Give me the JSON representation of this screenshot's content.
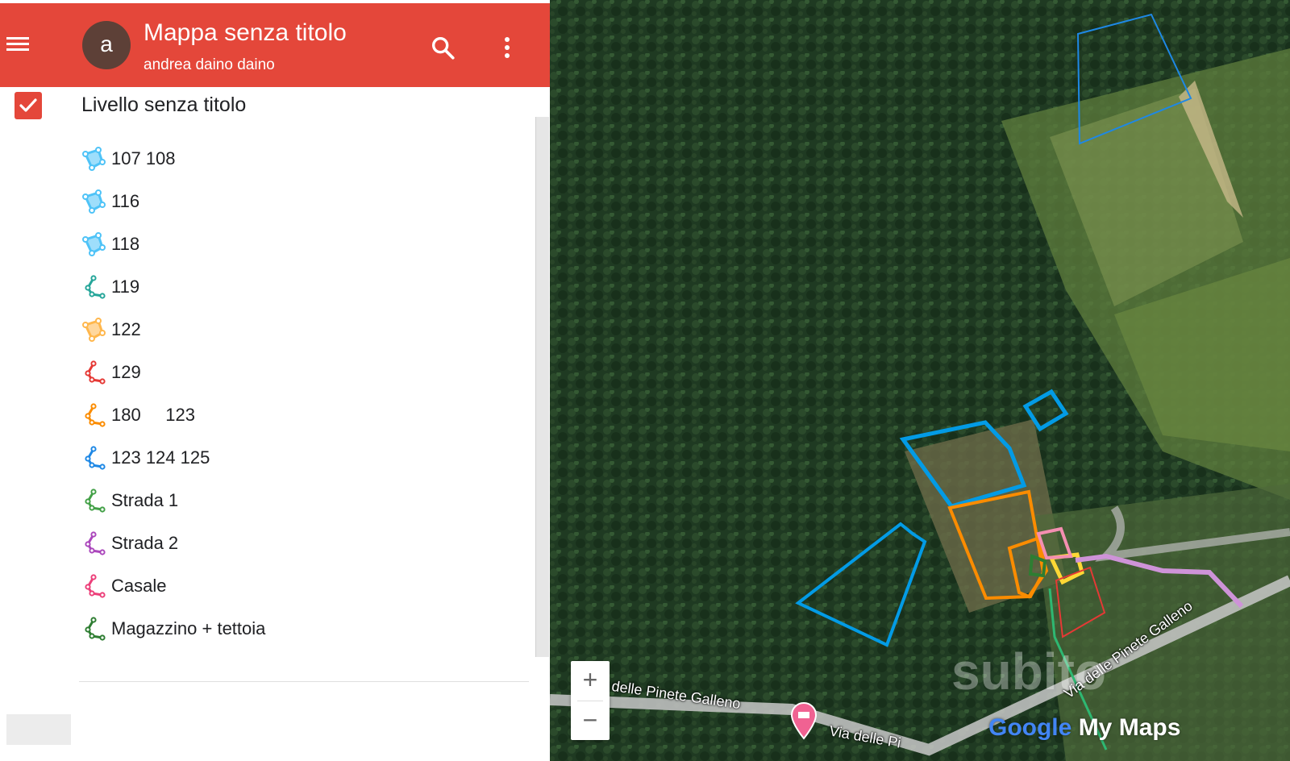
{
  "header": {
    "title": "Mappa senza titolo",
    "owner": "andrea daino daino",
    "avatar_letter": "a",
    "menu_icon": "hamburger-menu-icon",
    "search_icon": "search-icon",
    "more_icon": "more-vert-icon",
    "color": "#e4473a"
  },
  "layer": {
    "name": "Livello senza titolo",
    "checked": true,
    "features": [
      {
        "label": "107 108",
        "icon": "polygon-icon",
        "color": "#4fc3f7"
      },
      {
        "label": "116",
        "icon": "polygon-icon",
        "color": "#4fc3f7"
      },
      {
        "label": "118",
        "icon": "polygon-icon",
        "color": "#4fc3f7"
      },
      {
        "label": "119",
        "icon": "line-icon",
        "color": "#26a69a"
      },
      {
        "label": "122",
        "icon": "polygon-icon",
        "color": "#ffb74d"
      },
      {
        "label": "129",
        "icon": "line-icon",
        "color": "#e53935"
      },
      {
        "label": "180     123",
        "icon": "line-icon",
        "color": "#fb8c00"
      },
      {
        "label": "123 124 125",
        "icon": "line-icon",
        "color": "#1e88e5"
      },
      {
        "label": "Strada 1",
        "icon": "line-icon",
        "color": "#43a047"
      },
      {
        "label": "Strada 2",
        "icon": "line-icon",
        "color": "#ab47bc"
      },
      {
        "label": "Casale",
        "icon": "line-icon",
        "color": "#ec407a"
      },
      {
        "label": "Magazzino + tettoia",
        "icon": "line-icon",
        "color": "#2e7d32"
      }
    ]
  },
  "map": {
    "zoom_in": "+",
    "zoom_out": "−",
    "road_labels": [
      "delle Pinete Galleno",
      "Via delle Pi",
      "Via delle Pinete Galleno"
    ],
    "attribution": {
      "google": "Google",
      "mymaps": "My Maps"
    },
    "watermark": "subito",
    "pin_icon": "lodging-pin-icon"
  }
}
